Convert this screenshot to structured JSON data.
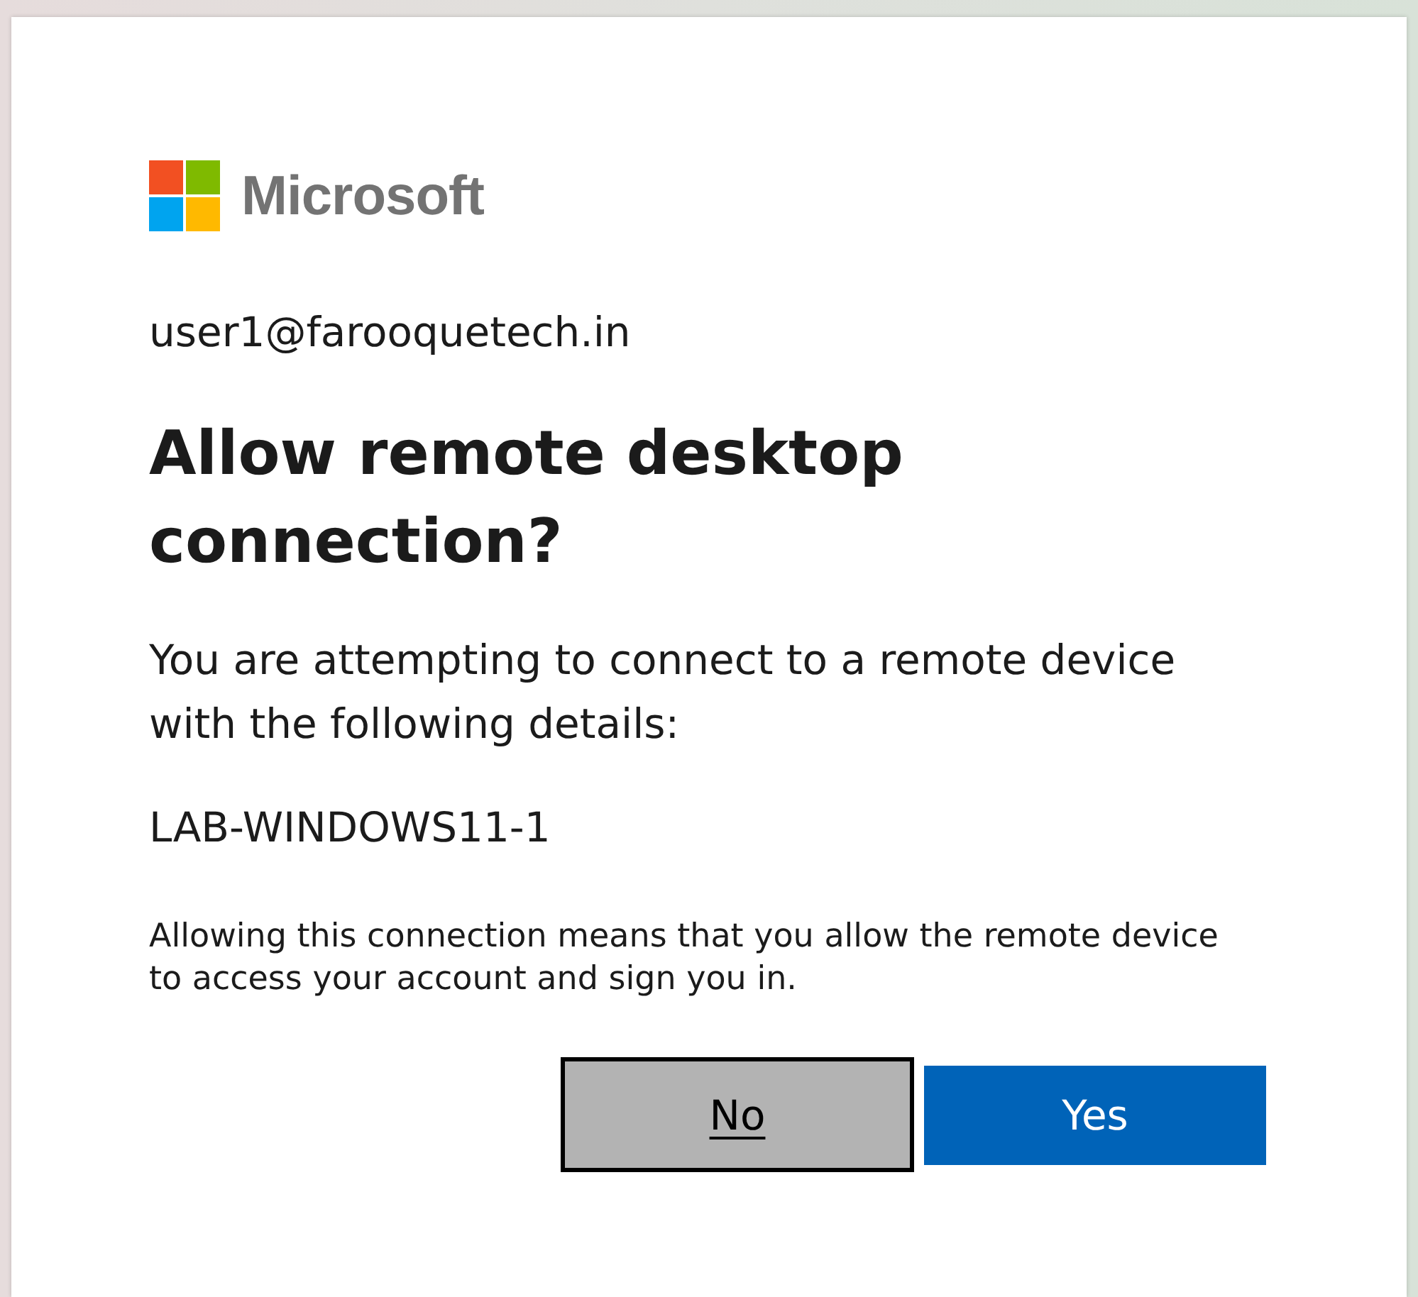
{
  "brand": {
    "name": "Microsoft"
  },
  "account": "user1@farooquetech.in",
  "title": "Allow remote desktop connection?",
  "message": "You are attempting to connect to a remote device with the following details:",
  "device_name": "LAB-WINDOWS11-1",
  "notice": "Allowing this connection means that you allow the remote device to access your account and sign you in.",
  "buttons": [
    {
      "label": "No",
      "kind": "secondary",
      "focused": true
    },
    {
      "label": "Yes",
      "kind": "primary",
      "focused": false
    }
  ]
}
